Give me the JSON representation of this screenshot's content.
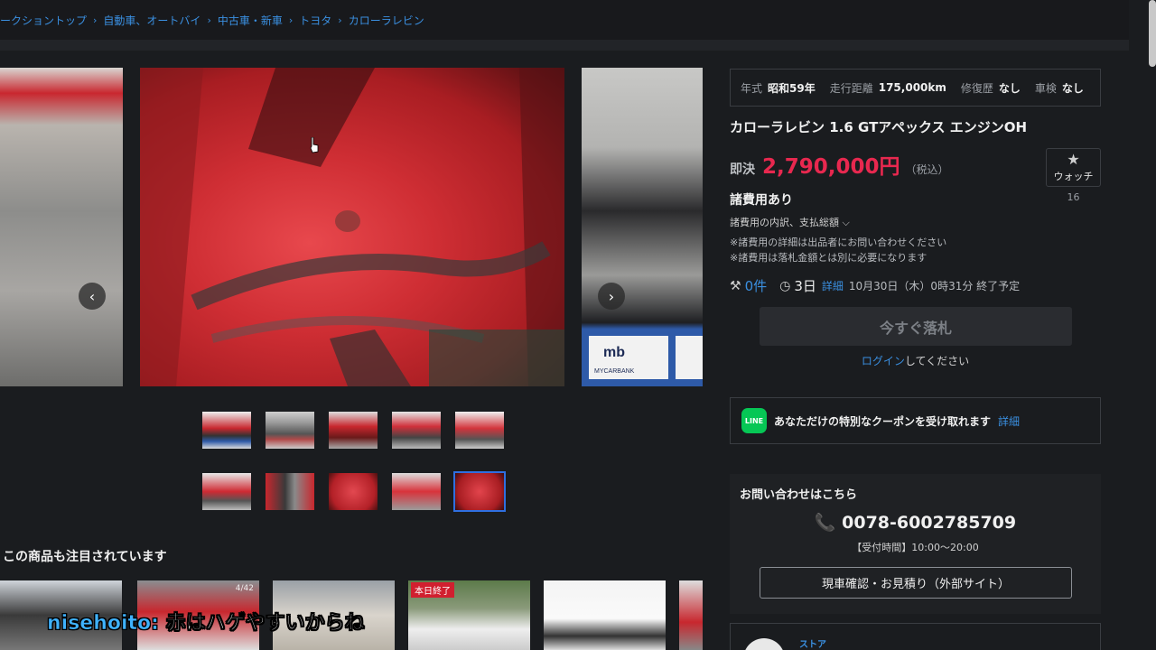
{
  "breadcrumb": [
    "ークショントップ",
    "自動車、オートバイ",
    "中古車・新車",
    "トヨタ",
    "カローラレビン"
  ],
  "specs": [
    {
      "k": "年式",
      "v": "昭和59年"
    },
    {
      "k": "走行距離",
      "v": "175,000km"
    },
    {
      "k": "修復歴",
      "v": "なし"
    },
    {
      "k": "車検",
      "v": "なし"
    }
  ],
  "item": {
    "title": "カローラレビン 1.6 GTアペックス エンジンOH",
    "price_label": "即決",
    "price": "2,790,000円",
    "tax": "（税込）",
    "watch_label": "ウォッチ",
    "watch_count": "16",
    "fee_head": "諸費用あり",
    "fee_detail": "諸費用の内訳、支払総額 ⌵",
    "fee_note1": "※諸費用の詳細は出品者にお問い合わせください",
    "fee_note2": "※諸費用は落札金額とは別に必要になります",
    "bids": "0件",
    "days": "3日",
    "detail_link": "詳細",
    "end_time": "10月30日（木）0時31分 終了予定",
    "buy_button": "今すぐ落札",
    "login_link": "ログイン",
    "login_suffix": "してください"
  },
  "coupon": {
    "icon_text": "LINE",
    "text": "あなただけの特別なクーポンを受け取れます",
    "link": "詳細"
  },
  "contact": {
    "head": "お問い合わせはこちら",
    "phone": "📞 0078-6002785709",
    "hours": "【受付時間】10:00〜20:00",
    "button": "現車確認・お見積り（外部サイト）"
  },
  "store": {
    "label": "ストア"
  },
  "related": {
    "title": "この商品も注目されています",
    "badge": "本日終了",
    "count": "4/42"
  },
  "subtitle": {
    "speaker": "nisehoito:",
    "message": "赤はハゲやすいからね"
  },
  "gallery": {
    "prev_icon": "‹",
    "next_icon": "›"
  },
  "colors": {
    "accent_blue": "#3a8fe0",
    "price_red": "#e8284f",
    "line_green": "#06c755"
  }
}
